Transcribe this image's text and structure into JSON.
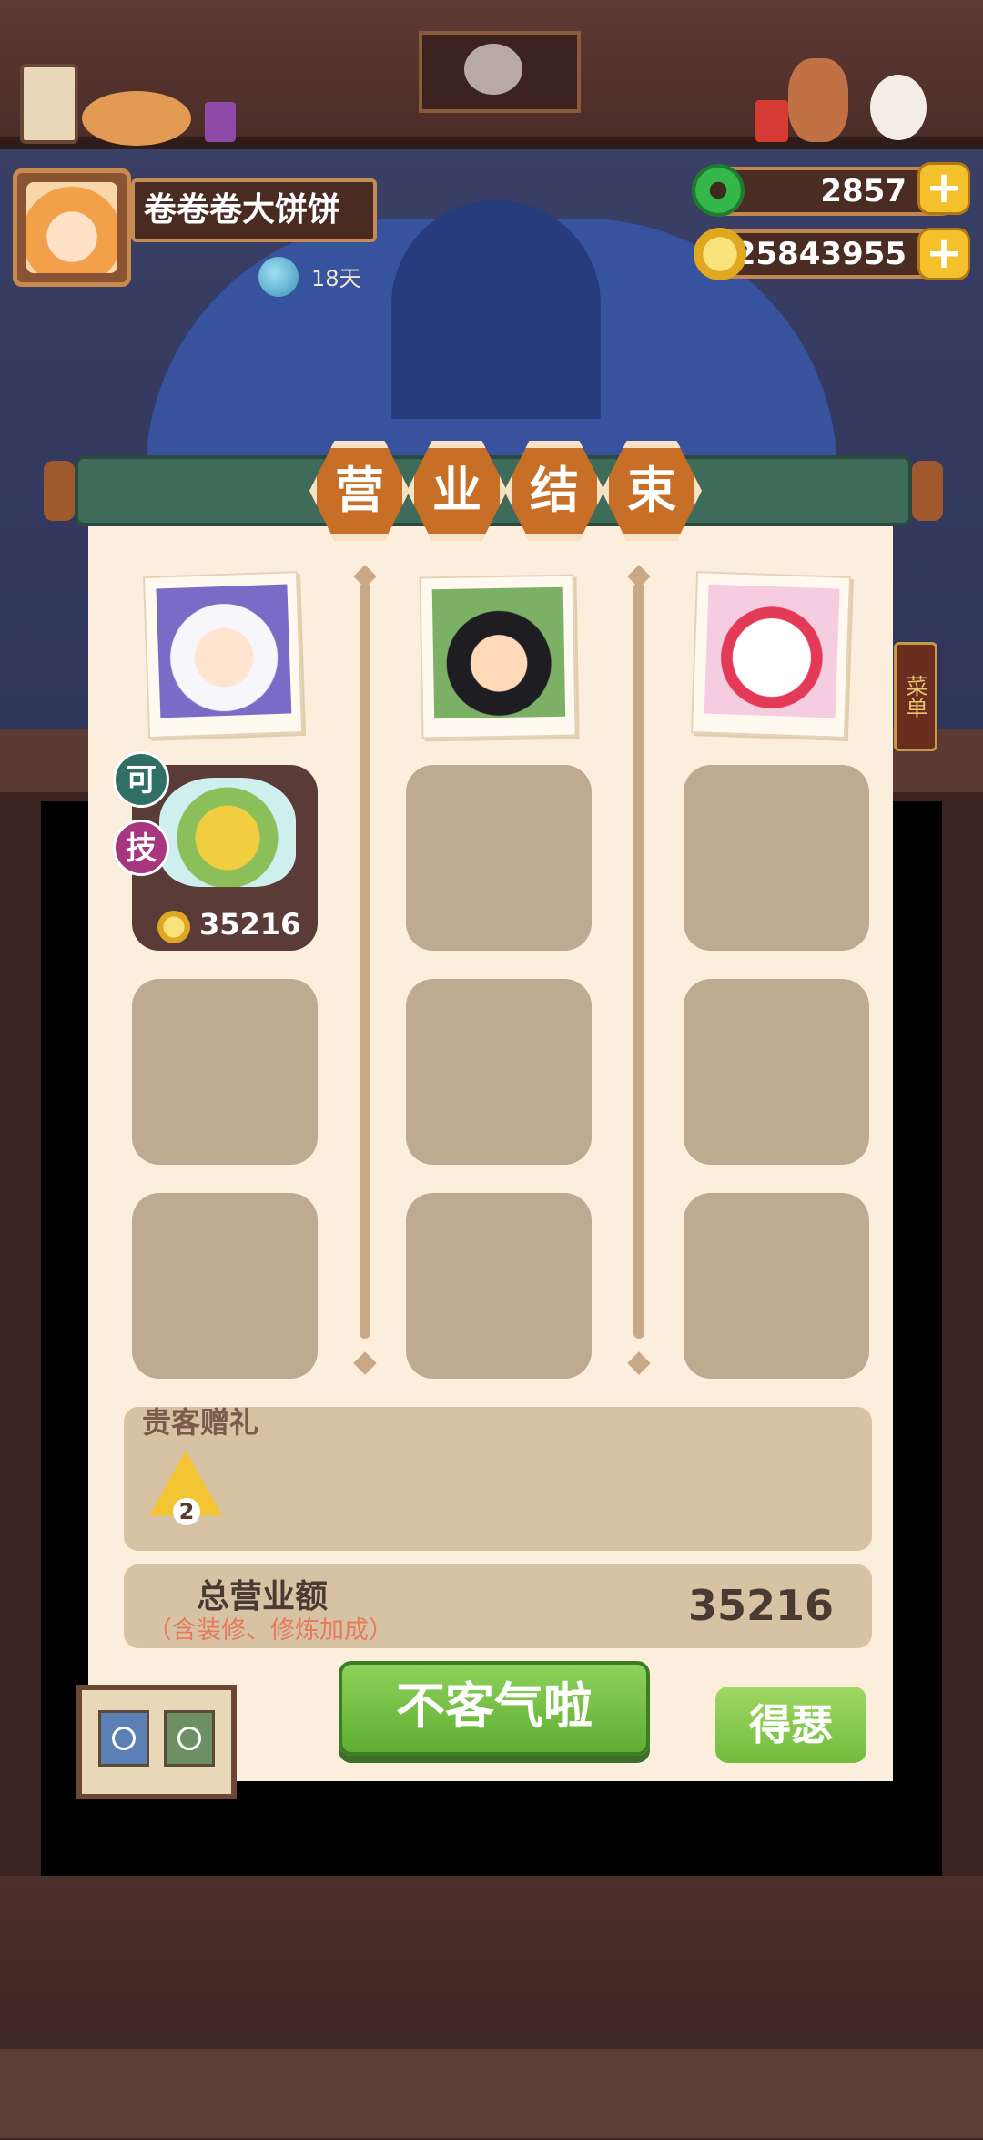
{
  "player": {
    "name": "卷卷卷大饼饼",
    "days": "18天"
  },
  "resources": {
    "jade": "2857",
    "coins": "25843955"
  },
  "banner": {
    "chars": [
      "营",
      "业",
      "结",
      "束"
    ]
  },
  "guests": [
    {
      "name": "guest-1"
    },
    {
      "name": "guest-2"
    },
    {
      "name": "guest-3"
    }
  ],
  "dish": {
    "price": "35216",
    "badge_top": "可",
    "badge_bottom": "技"
  },
  "gifts": {
    "title": "贵客赠礼",
    "count": "2"
  },
  "revenue": {
    "label": "总营业额",
    "note": "（含装修、修炼加成）",
    "value": "35216"
  },
  "buttons": {
    "main": "不客气啦",
    "side": "得瑟",
    "plus": "+"
  },
  "side_tag": "菜单",
  "colors": {
    "panel": "#fbeedd",
    "banner": "#3f6b5a",
    "hex": "#c86f27",
    "button_green": "#6fbf3f"
  }
}
